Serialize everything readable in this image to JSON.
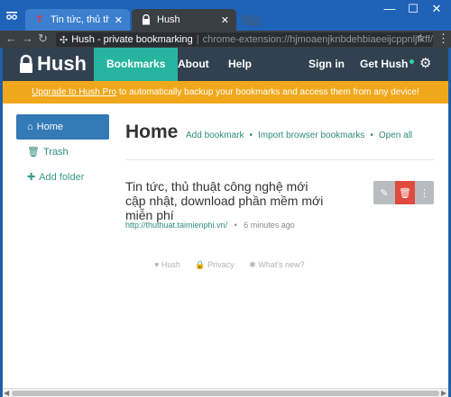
{
  "browser": {
    "tabs": [
      {
        "title": "Tin tức, thủ thuật công",
        "icon": "thuthuat-favicon"
      },
      {
        "title": "Hush",
        "icon": "lock-favicon"
      }
    ],
    "omnibox": {
      "site_label": "Hush - private bookmarking",
      "url": "chrome-extension://hjmoaenjknbdehbiaeeijcppnljfkff/app/"
    }
  },
  "app": {
    "brand": "Hush",
    "nav": {
      "bookmarks": "Bookmarks",
      "about": "About",
      "help": "Help",
      "signin": "Sign in",
      "gethush": "Get Hush"
    },
    "banner": {
      "link": "Upgrade to Hush Pro",
      "text": " to automatically backup your bookmarks and access them from any device!"
    },
    "sidebar": {
      "items": [
        {
          "label": "Home",
          "icon": "home-icon"
        },
        {
          "label": "Trash",
          "icon": "trash-icon"
        },
        {
          "label": "Add folder",
          "icon": "plus-icon"
        }
      ]
    },
    "main": {
      "title": "Home",
      "links": [
        "Add bookmark",
        "Import browser bookmarks",
        "Open all"
      ]
    },
    "bookmark": {
      "title": "Tin tức, thủ thuật công nghệ mới cập nhật, download phần mềm mới miễn phí",
      "url": "http://thuthuat.taimienphi.vn/",
      "time": "6 minutes ago"
    },
    "footer": [
      "Hush",
      "Privacy",
      "What's new?"
    ]
  },
  "colors": {
    "accent": "#27b49e",
    "nav_bg": "#32414f",
    "banner_bg": "#f0a81b",
    "active_side": "#337ab7",
    "delete_red": "#e04b3f"
  }
}
